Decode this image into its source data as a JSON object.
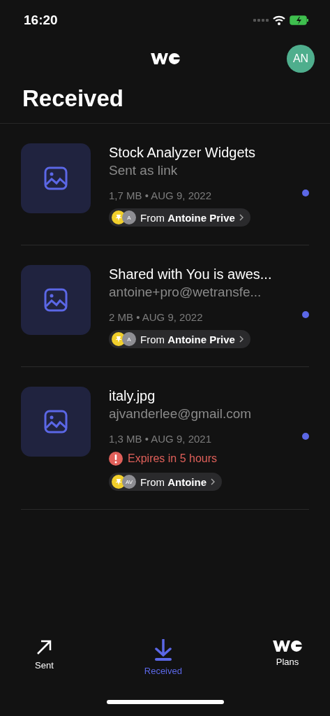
{
  "status_bar": {
    "time": "16:20"
  },
  "header": {
    "avatar": "AN",
    "title": "Received"
  },
  "transfers": [
    {
      "title": "Stock Analyzer Widgets",
      "subtitle": "Sent as link",
      "meta": "1,7 MB • AUG 9, 2022",
      "unread": true,
      "from_label": "From",
      "sender": "Antoine Prive",
      "sender_initials": "A"
    },
    {
      "title": "Shared with You is awes...",
      "subtitle": "antoine+pro@wetransfe...",
      "meta": "2 MB • AUG 9, 2022",
      "unread": true,
      "from_label": "From",
      "sender": "Antoine Prive",
      "sender_initials": "A"
    },
    {
      "title": "italy.jpg",
      "subtitle": "ajvanderlee@gmail.com",
      "meta": "1,3 MB • AUG 9, 2021",
      "unread": true,
      "warning": "Expires in 5 hours",
      "from_label": "From",
      "sender": "Antoine",
      "sender_initials": "AV"
    }
  ],
  "tabs": [
    {
      "label": "Sent",
      "kind": "sent",
      "selected": false
    },
    {
      "label": "Received",
      "kind": "received",
      "selected": true
    },
    {
      "label": "Plans",
      "kind": "plans",
      "selected": false
    }
  ]
}
